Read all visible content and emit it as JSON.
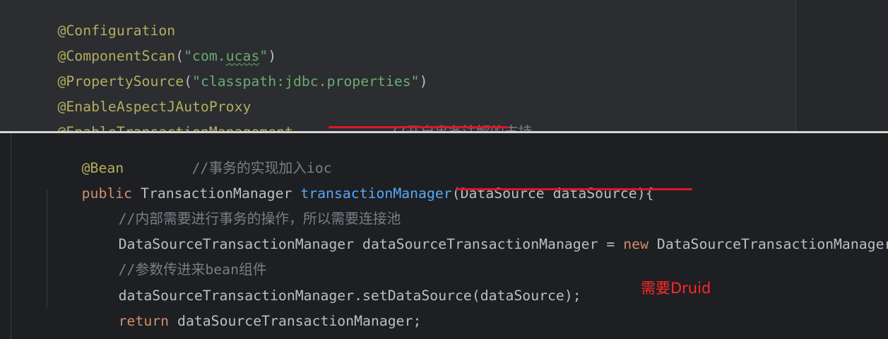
{
  "top_snippet": {
    "lines": [
      {
        "ann": "@Configuration"
      },
      {
        "ann": "@ComponentScan",
        "open": "(",
        "str_prefix": "\"com.",
        "str_typo": "ucas",
        "str_suffix": "\"",
        "close": ")"
      },
      {
        "ann": "@PropertySource",
        "open": "(",
        "str": "\"classpath:jdbc.properties\"",
        "close": ")"
      },
      {
        "ann": "@EnableAspectJAutoProxy"
      },
      {
        "ann": "@EnableTransactionManagement",
        "comment": "//开启事务注解的支持"
      }
    ]
  },
  "editor": {
    "bean_line": {
      "ann": "@Bean",
      "comment": "//事务的实现加入ioc"
    },
    "signature": {
      "kw": "public",
      "type": "TransactionManager",
      "method": "transactionManager",
      "params": "(DataSource dataSource){"
    },
    "comment_pool": "//内部需要进行事务的操作，所以需要连接池",
    "decl": {
      "type": "DataSourceTransactionManager",
      "var": "dataSourceTransactionManager",
      "assign": "=",
      "kw_new": "new",
      "ctor": "DataSourceTransactionManager"
    },
    "comment_param": "//参数传进来bean组件",
    "setter_call": "dataSourceTransactionManager.setDataSource(dataSource);",
    "return_line": {
      "kw": "return",
      "value": "dataSourceTransactionManager;"
    },
    "closing_brace": "}"
  },
  "note": "需要Druid",
  "colors": {
    "annotation": "#b3ae60",
    "keyword": "#cf8e6d",
    "string": "#6aab73",
    "comment": "#7a7e85",
    "method": "#56a8f5",
    "text": "#bcbec4",
    "highlight_red": "#e0142a"
  }
}
